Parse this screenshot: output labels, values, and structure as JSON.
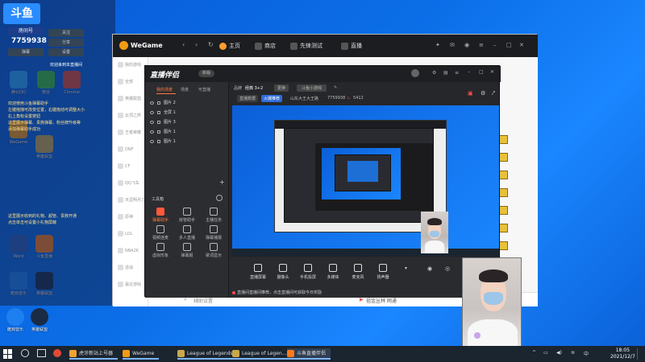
{
  "desktop": {
    "icons": [
      {
        "label": "腾讯QQ",
        "color": "#2aa8ff"
      },
      {
        "label": "微信",
        "color": "#3fbf3f"
      },
      {
        "label": "Chrome",
        "color": "#e24a36"
      },
      {
        "label": "WeGame",
        "color": "#f39c12"
      },
      {
        "label": "英雄联盟",
        "color": "#c9a84c"
      },
      {
        "label": "Word",
        "color": "#2b5cb8"
      },
      {
        "label": "斗鱼直播",
        "color": "#ff7a1a"
      },
      {
        "label": "酷狗音乐",
        "color": "#1e7ff0"
      },
      {
        "label": "英雄联盟",
        "color": "#1a2b45"
      }
    ],
    "bottom_icons": [
      {
        "label": "酷狗音乐"
      },
      {
        "label": "英雄联盟"
      }
    ]
  },
  "chat": {
    "logo": "斗鱼",
    "room_label": "房间号",
    "room_number": "7759938",
    "buttons": [
      "关注",
      "分享",
      "设置",
      "弹幕"
    ],
    "welcome": "欢迎来到本直播间",
    "lines": [
      "欢迎使用斗鱼弹幕助手",
      "左键拖拽可改变位置，右键拖动可调整大小",
      "右上角有设置按钮",
      "这里展示弹幕、贵族弹幕、粉丝牌升级等",
      "添加弹幕助手成功"
    ],
    "gift_lines": [
      "这里展示收到的礼物、超管、贵族开通",
      "点击单击可设置小礼物屏蔽"
    ]
  },
  "wegame": {
    "logo": "WeGame",
    "tabs": [
      "主页",
      "商店",
      "先锋测试",
      "直播"
    ],
    "side_items": [
      "我的游戏",
      "全部",
      "英雄联盟",
      "云顶之弈",
      "王者荣耀",
      "DNF",
      "CF",
      "QQ飞车",
      "天涯明月刀",
      "原神",
      "LOL",
      "NBA2K",
      "逆战",
      "最近游戏"
    ],
    "search_placeholder": "辅助设置",
    "net_status": "祖金丛林 网通"
  },
  "companion": {
    "logo": "直播伴侣",
    "edition": "新版",
    "left_tabs": [
      "我的场景",
      "场景",
      "可直播"
    ],
    "scenes": [
      "图片 2",
      "全屏 1",
      "图片 3",
      "图片 1",
      "图片 1"
    ],
    "toolbox_title": "工具箱",
    "tools": [
      {
        "label": "弹幕助手",
        "hot": true
      },
      {
        "label": "房管助手",
        "hot": false
      },
      {
        "label": "主播任务",
        "hot": false
      },
      {
        "label": "视频连麦",
        "hot": false
      },
      {
        "label": "多人直播",
        "hot": false
      },
      {
        "label": "弹幕播报",
        "hot": false
      },
      {
        "label": "虚拟形象",
        "hot": false
      },
      {
        "label": "弹幕姬",
        "hot": false
      },
      {
        "label": "歌词显示",
        "hot": false
      }
    ],
    "info": {
      "category_label": "品牌",
      "category": "经典 3+2",
      "change": "更换",
      "topic": "斗鱼小游戏",
      "status_label": "直播数据",
      "status": "火爆推荐",
      "location": "山东大王大王路",
      "room_id": "7759938",
      "fans": "5412"
    },
    "bottom_tools": [
      "直播屏幕",
      "摄像头",
      "手机投屏",
      "多媒体",
      "麦克风",
      "扬声器"
    ],
    "notice": "直播间直播间推荐，点击直播间可获取今日奖励"
  },
  "taskbar": {
    "apps": [
      {
        "label": "虎牙新站上号器",
        "color": "#f3a12f",
        "active": false
      },
      {
        "label": "WeGame",
        "color": "#f39c12",
        "active": false
      },
      {
        "label": "League of Legends",
        "color": "#c9a84c",
        "active": false
      },
      {
        "label": "League of Legen...",
        "color": "#c9a84c",
        "active": false
      },
      {
        "label": "斗鱼直播伴侣",
        "color": "#ff7a1a",
        "active": true
      }
    ],
    "time": "18:05",
    "date": "2021/12/7"
  }
}
